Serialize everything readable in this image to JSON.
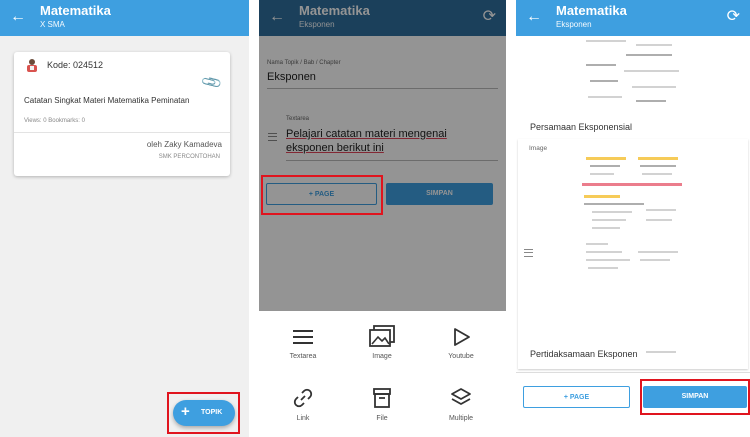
{
  "screen1": {
    "appbar": {
      "back": "←",
      "title": "Matematika",
      "subtitle": "X SMA"
    },
    "card": {
      "kode": "Kode: 024512",
      "title": "Catatan Singkat Materi Matematika Peminatan",
      "meta": "Views: 0   Bookmarks: 0",
      "author": "oleh Zaky Kamadeva",
      "school": "SMK PERCONTOHAN"
    },
    "fab": {
      "icon": "+",
      "label": "TOPIK"
    }
  },
  "screen2": {
    "appbar": {
      "back": "←",
      "title": "Matematika",
      "subtitle": "Eksponen",
      "refresh": "⟳"
    },
    "topic_label": "Nama Topik / Bab / Chapter",
    "topic_value": "Eksponen",
    "textarea_label": "Textarea",
    "textarea_value": "Pelajari catatan materi mengenai eksponen berikut ini",
    "page_button": "+ PAGE",
    "save_button": "SIMPAN",
    "sheet": [
      {
        "icon": "menu-lines-icon",
        "label": "Textarea"
      },
      {
        "icon": "image-icon",
        "label": "Image"
      },
      {
        "icon": "play-icon",
        "label": "Youtube"
      },
      {
        "icon": "link-icon",
        "label": "Link"
      },
      {
        "icon": "archive-icon",
        "label": "File"
      },
      {
        "icon": "layers-icon",
        "label": "Multiple"
      }
    ]
  },
  "screen3": {
    "appbar": {
      "back": "←",
      "title": "Matematika",
      "subtitle": "Eksponen",
      "refresh": "⟳"
    },
    "section1": "Persamaan Eksponensial",
    "image_label": "Image",
    "section2": "Pertidaksamaan Eksponen",
    "page_button": "+ PAGE",
    "save_button": "SIMPAN"
  },
  "colors": {
    "accent": "#3e9fe0",
    "highlight": "#e0141e"
  }
}
